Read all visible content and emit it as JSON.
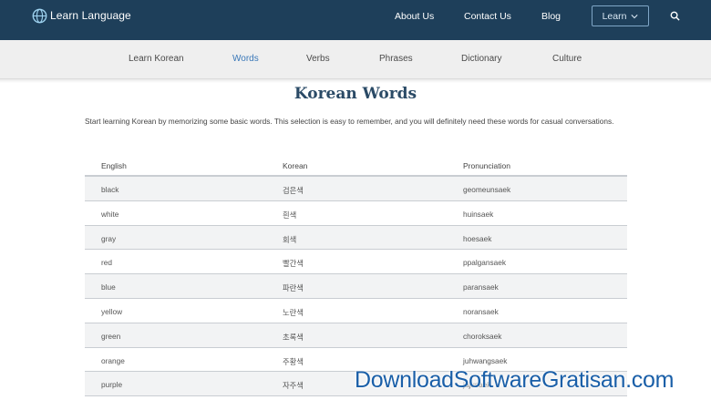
{
  "header": {
    "logo_text": "Learn🌐Language",
    "logo_display": "Learn Language",
    "nav": [
      {
        "label": "About Us"
      },
      {
        "label": "Contact Us"
      },
      {
        "label": "Blog"
      }
    ],
    "learn_button": "Learn",
    "icons": [
      "globe-icon",
      "chevron-down-icon",
      "search-icon"
    ],
    "bar_color": "#1e3f5a"
  },
  "subnav": {
    "items": [
      {
        "label": "Learn Korean"
      },
      {
        "label": "Words",
        "active": true
      },
      {
        "label": "Verbs"
      },
      {
        "label": "Phrases"
      },
      {
        "label": "Dictionary"
      },
      {
        "label": "Culture"
      }
    ],
    "active_color": "#3a78b8"
  },
  "main": {
    "title": "Korean Words",
    "intro": "Start learning Korean by memorizing some basic words. This selection is easy to remember, and you will definitely need these words for casual conversations.",
    "table": {
      "headers": [
        "English",
        "Korean",
        "Pronunciation"
      ],
      "rows": [
        {
          "english": "black",
          "korean": "검은색",
          "pron": "geomeunsaek"
        },
        {
          "english": "white",
          "korean": "흰색",
          "pron": "huinsaek"
        },
        {
          "english": "gray",
          "korean": "회색",
          "pron": "hoesaek"
        },
        {
          "english": "red",
          "korean": "빨간색",
          "pron": "ppalgansaek"
        },
        {
          "english": "blue",
          "korean": "파란색",
          "pron": "paransaek"
        },
        {
          "english": "yellow",
          "korean": "노란색",
          "pron": "noransaek"
        },
        {
          "english": "green",
          "korean": "초록색",
          "pron": "choroksaek"
        },
        {
          "english": "orange",
          "korean": "주황색",
          "pron": "juhwangsaek"
        },
        {
          "english": "purple",
          "korean": "자주색",
          "pron": "jajusaek"
        }
      ]
    }
  },
  "watermark": "DownloadSoftwareGratisan.com"
}
